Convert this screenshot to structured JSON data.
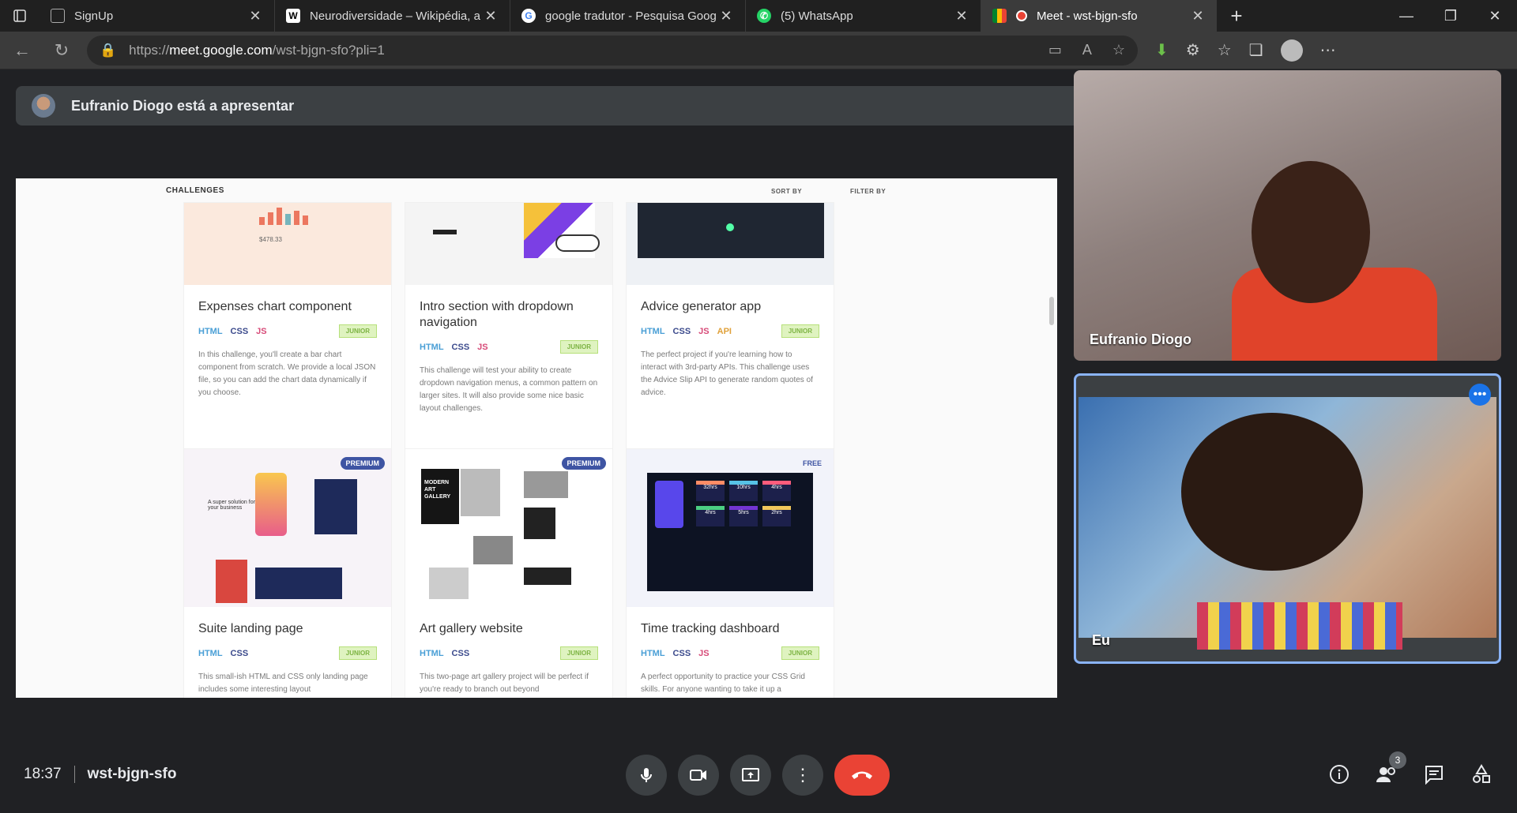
{
  "browser": {
    "tabs": [
      {
        "label": "SignUp",
        "favicon": "page-icon"
      },
      {
        "label": "Neurodiversidade – Wikipédia, a",
        "favicon": "wikipedia-icon"
      },
      {
        "label": "google tradutor - Pesquisa Goog",
        "favicon": "google-icon"
      },
      {
        "label": "(5) WhatsApp",
        "favicon": "whatsapp-icon"
      },
      {
        "label": "Meet - wst-bjgn-sfo",
        "favicon": "meet-icon"
      }
    ],
    "url_prefix": "https://",
    "url_host": "meet.google.com",
    "url_path": "/wst-bjgn-sfo?pli=1"
  },
  "meet": {
    "presenting_banner": "Eufranio Diogo está a apresentar",
    "participants": [
      {
        "name": "Eufranio Diogo"
      },
      {
        "name": "Eu"
      }
    ],
    "time": "18:37",
    "meeting_code": "wst-bjgn-sfo",
    "people_count": "3"
  },
  "shared_screen": {
    "header": "CHALLENGES",
    "sort_label": "SORT BY",
    "filter_label": "FILTER BY",
    "cards": [
      {
        "title": "Expenses chart component",
        "tags": [
          "HTML",
          "CSS",
          "JS"
        ],
        "level": "JUNIOR",
        "desc": "In this challenge, you'll create a bar chart component from scratch. We provide a local JSON file, so you can add the chart data dynamically if you choose.",
        "thumb_price": "$478.33"
      },
      {
        "title": "Intro section with dropdown navigation",
        "tags": [
          "HTML",
          "CSS",
          "JS"
        ],
        "level": "JUNIOR",
        "desc": "This challenge will test your ability to create dropdown navigation menus, a common pattern on larger sites. It will also provide some nice basic layout challenges."
      },
      {
        "title": "Advice generator app",
        "tags": [
          "HTML",
          "CSS",
          "JS",
          "API"
        ],
        "level": "JUNIOR",
        "desc": "The perfect project if you're learning how to interact with 3rd-party APIs. This challenge uses the Advice Slip API to generate random quotes of advice."
      },
      {
        "title": "Suite landing page",
        "tags": [
          "HTML",
          "CSS"
        ],
        "level": "JUNIOR",
        "desc": "This small-ish HTML and CSS only landing page includes some interesting layout",
        "badge": "PREMIUM",
        "thumb_text": "A super solution for your business"
      },
      {
        "title": "Art gallery website",
        "tags": [
          "HTML",
          "CSS"
        ],
        "level": "JUNIOR",
        "desc": "This two-page art gallery project will be perfect if you're ready to branch out beyond",
        "badge": "PREMIUM",
        "thumb_text": "MODERN ART GALLERY"
      },
      {
        "title": "Time tracking dashboard",
        "tags": [
          "HTML",
          "CSS",
          "JS"
        ],
        "level": "JUNIOR",
        "desc": "A perfect opportunity to practice your CSS Grid skills. For anyone wanting to take it up a",
        "badge": "FREE",
        "thumb_values": [
          "32hrs",
          "10hrs",
          "4hrs",
          "4hrs",
          "5hrs",
          "2hrs"
        ]
      }
    ]
  },
  "colors": {
    "meet_bg": "#202124",
    "end_call": "#ea4335",
    "active_speaker_border": "#8ab4f8",
    "premium_badge": "#3e54a3"
  }
}
